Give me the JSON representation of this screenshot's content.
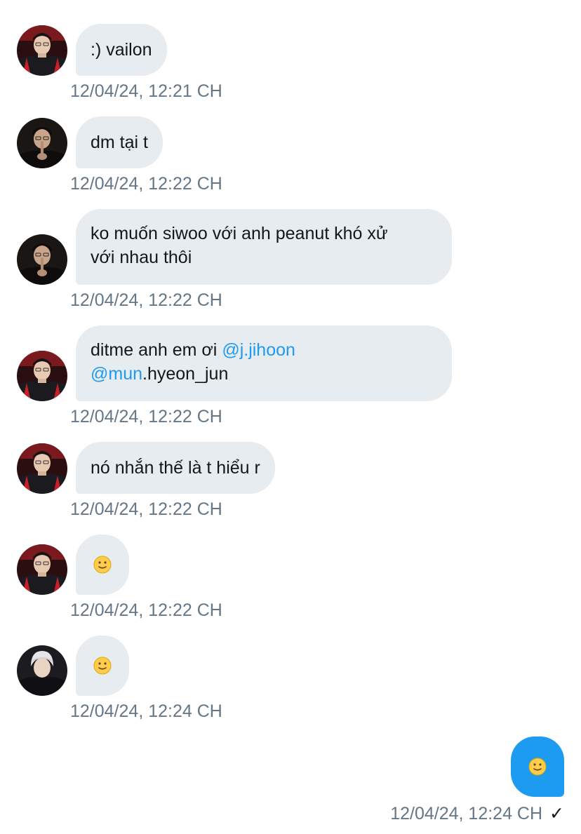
{
  "conversation": {
    "messages": [
      {
        "sender": "user-a",
        "text": ":) vailon",
        "timestamp": "12/04/24, 12:21 CH"
      },
      {
        "sender": "user-b",
        "text": "dm tại t",
        "timestamp": "12/04/24, 12:22 CH"
      },
      {
        "sender": "user-b",
        "line1": "ko muốn siwoo với anh peanut khó xử",
        "line2": "với nhau thôi",
        "timestamp": "12/04/24, 12:22 CH"
      },
      {
        "sender": "user-a",
        "prefix": "ditme anh em ơi ",
        "mention1": "@j.jihoon",
        "mention2": "@mun",
        "suffix2": ".hyeon_jun",
        "timestamp": "12/04/24, 12:22 CH"
      },
      {
        "sender": "user-a",
        "text": "nó nhắn thế là t hiểu r",
        "timestamp": "12/04/24, 12:22 CH"
      },
      {
        "sender": "user-a",
        "emoji": "slightly-smiling-face",
        "timestamp": "12/04/24, 12:22 CH"
      },
      {
        "sender": "user-c",
        "emoji": "slightly-smiling-face",
        "timestamp": "12/04/24, 12:24 CH"
      }
    ],
    "outgoing": {
      "emoji": "slightly-smiling-face",
      "timestamp": "12/04/24, 12:24 CH",
      "status_icon": "checkmark-icon",
      "status_glyph": "✓"
    }
  },
  "colors": {
    "incoming_bubble": "#e6ecf0",
    "outgoing_bubble": "#1d9bf0",
    "mention": "#1d9bf0",
    "timestamp": "#657786",
    "text": "#14171a"
  }
}
